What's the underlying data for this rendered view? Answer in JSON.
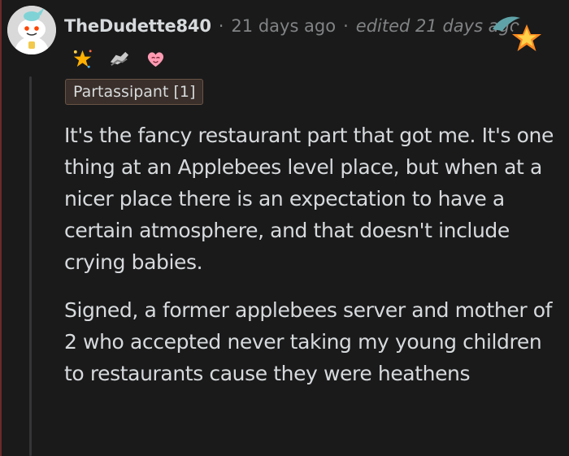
{
  "comment": {
    "username": "TheDudette840",
    "separator": "·",
    "posted_ago": "21 days ago",
    "edited_label": "edited 21 days ago",
    "flair": "Partassipant [1]",
    "paragraphs": [
      "It's the fancy restaurant part that got me. It's one thing at an Applebees level place, but when at a nicer place there is an expectation to have a certain atmosphere, and that doesn't include crying babies.",
      "Signed, a former applebees server and mother of 2 who accepted never taking my young children to restaurants cause they were heathens"
    ],
    "awards": [
      "starstruck-award-icon",
      "helping-hand-award-icon",
      "wholesome-heart-award-icon",
      "gold-star-award-icon"
    ]
  },
  "colors": {
    "background": "#1a1a1b",
    "text": "#d7dadc",
    "meta_text": "#818384",
    "flair_background": "#3a2f2a"
  }
}
